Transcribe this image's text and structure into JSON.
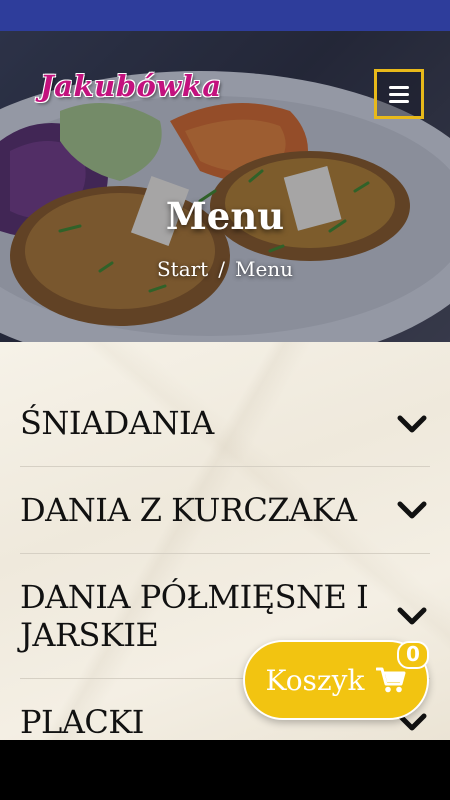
{
  "app": {
    "logo_text": "Jakubówka",
    "brand_color": "#c3127e",
    "accent_color": "#f2c411",
    "status_bar_color": "#2e3d9b"
  },
  "header": {
    "menu_toggle_icon": "hamburger-icon"
  },
  "hero": {
    "title": "Menu",
    "breadcrumb": {
      "home": "Start",
      "separator": "/",
      "current": "Menu"
    }
  },
  "menu_categories": [
    {
      "label": "ŚNIADANIA",
      "icon": "chevron-down-icon"
    },
    {
      "label": "DANIA Z KURCZAKA",
      "icon": "chevron-down-icon"
    },
    {
      "label": "DANIA PÓŁMIĘSNE I JARSKIE",
      "icon": "chevron-down-icon"
    },
    {
      "label": "PLACKI",
      "icon": "chevron-down-icon"
    }
  ],
  "cart": {
    "label": "Koszyk",
    "icon": "cart-icon",
    "count": "0"
  }
}
